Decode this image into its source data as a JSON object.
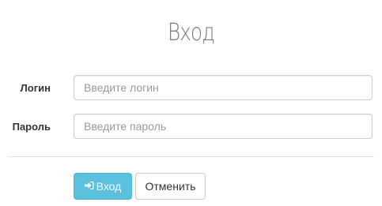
{
  "form": {
    "title": "Вход",
    "login_label": "Логин",
    "login_placeholder": "Введите логин",
    "login_value": "",
    "password_label": "Пароль",
    "password_placeholder": "Введите пароль",
    "password_value": ""
  },
  "actions": {
    "submit_label": "Вход",
    "submit_icon": "sign-in-icon",
    "cancel_label": "Отменить"
  },
  "colors": {
    "primary_button": "#5bc0de",
    "primary_button_border": "#46b8da",
    "title_text": "#7a7a7a",
    "label_text": "#333333"
  }
}
